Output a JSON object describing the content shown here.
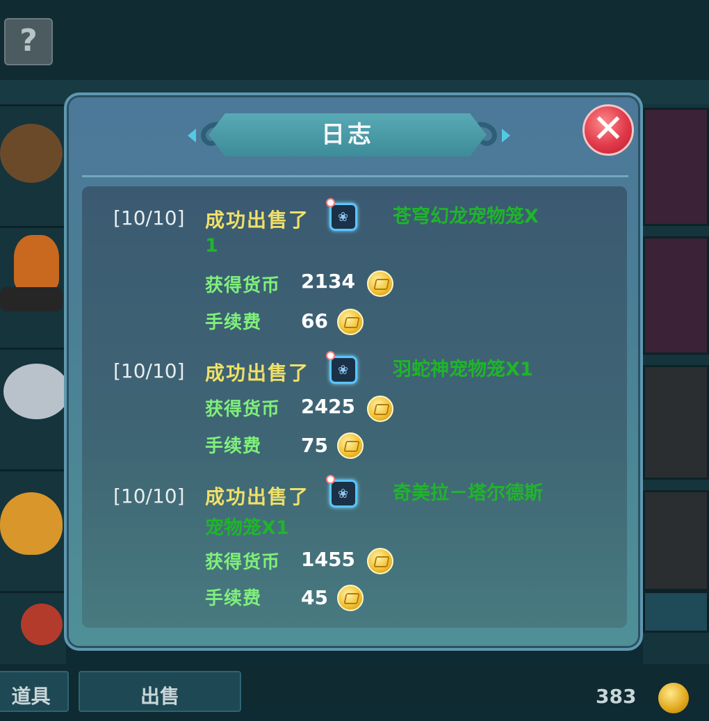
{
  "background": {
    "help_label": "?",
    "tabs": [
      "道具",
      "出售"
    ],
    "coins": "383"
  },
  "dialog": {
    "title": "日志",
    "close_label": "✕",
    "entries": [
      {
        "date": "[10/10]",
        "action": "成功出售了",
        "item_name": "苍穹幻龙宠物笼X",
        "item_name_cont": "1",
        "income_label": "获得货币",
        "income": "2134",
        "fee_label": "手续费",
        "fee": "66"
      },
      {
        "date": "[10/10]",
        "action": "成功出售了",
        "item_name": "羽蛇神宠物笼X1",
        "item_name_cont": "",
        "income_label": "获得货币",
        "income": "2425",
        "fee_label": "手续费",
        "fee": "75"
      },
      {
        "date": "[10/10]",
        "action": "成功出售了",
        "item_name": "奇美拉－塔尔德斯",
        "item_name_cont": "宠物笼X1",
        "income_label": "获得货币",
        "income": "1455",
        "fee_label": "手续费",
        "fee": "45"
      }
    ]
  },
  "colors": {
    "title": "#f4f8fa",
    "action": "#f0e068",
    "item_name": "#1fb52a",
    "label": "#7ff07a",
    "close": "#e0394a"
  },
  "icons": {
    "pet": "pet-cage-icon",
    "coin": "coin-icon",
    "close": "close-icon",
    "help": "help-icon"
  }
}
